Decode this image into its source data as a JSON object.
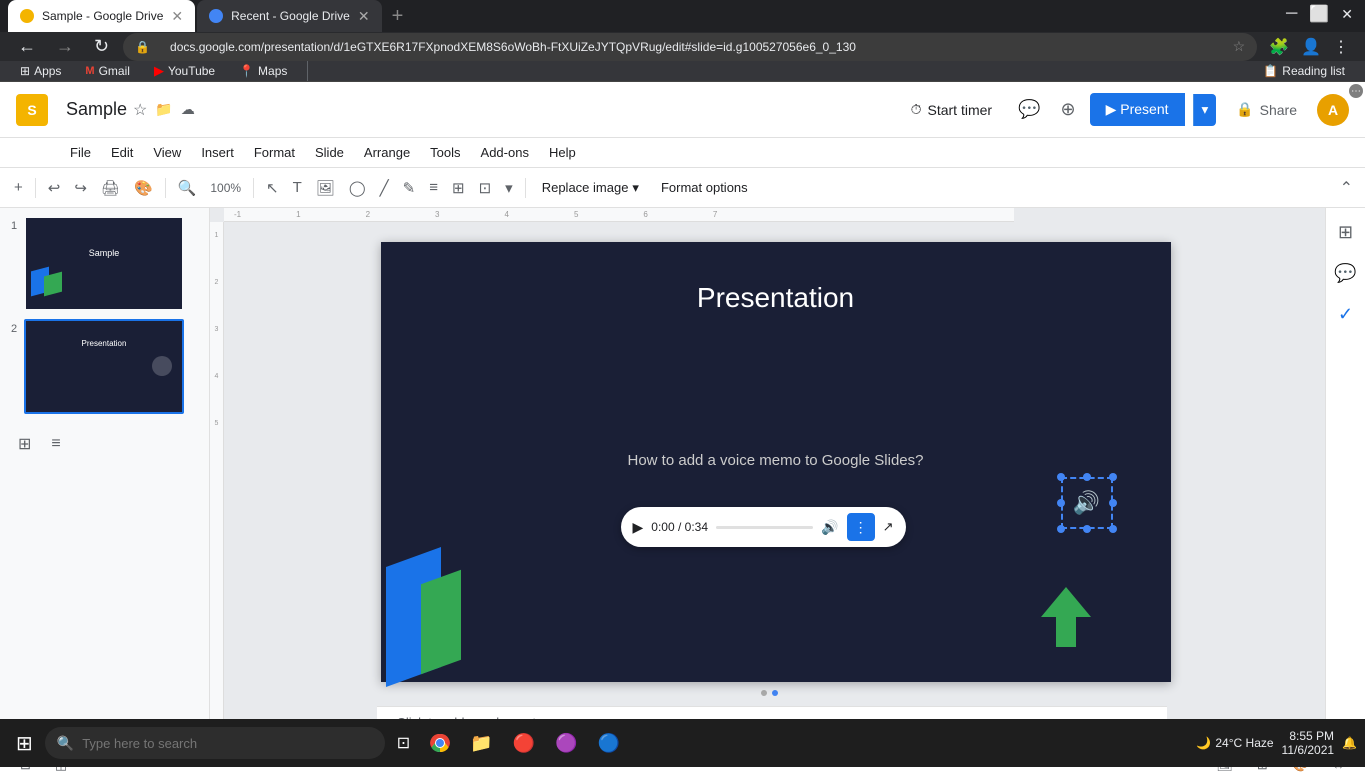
{
  "browser": {
    "tabs": [
      {
        "id": "tab1",
        "title": "Sample - Google Drive",
        "favicon": "📄",
        "active": true
      },
      {
        "id": "tab2",
        "title": "Recent - Google Drive",
        "favicon": "🔵",
        "active": false
      }
    ],
    "address": "docs.google.com/presentation/d/1eGTXE6R17FXpnodXEM8S6oWoBh-FtXUiZeJYTQpVRug/edit#slide=id.g100527056e6_0_130",
    "bookmarks": [
      {
        "id": "apps",
        "label": "Apps",
        "icon": "⚙"
      },
      {
        "id": "gmail",
        "label": "Gmail",
        "icon": "M"
      },
      {
        "id": "youtube",
        "label": "YouTube",
        "icon": "▶"
      },
      {
        "id": "maps",
        "label": "Maps",
        "icon": "📍"
      }
    ],
    "reading_list": "Reading list"
  },
  "app": {
    "title": "Sample",
    "logo_letter": "S",
    "menu": [
      "File",
      "Edit",
      "View",
      "Insert",
      "Format",
      "Slide",
      "Arrange",
      "Tools",
      "Add-ons",
      "Help"
    ],
    "header": {
      "start_timer": "Start timer",
      "present": "Present",
      "share": "Share",
      "user_initial": "A"
    },
    "toolbar": {
      "replace_image": "Replace image",
      "format_options": "Format options"
    },
    "slides": [
      {
        "num": "1",
        "title": "Sample"
      },
      {
        "num": "2",
        "title": "Presentation"
      }
    ],
    "slide": {
      "title": "Presentation",
      "subtitle": "How to add a voice memo to Google Slides?",
      "audio_time": "0:00 / 0:34"
    },
    "speaker_notes": "Click to add speaker notes"
  },
  "taskbar": {
    "search_placeholder": "Type here to search",
    "weather": "24°C  Haze",
    "time": "8:55 PM",
    "date": "11/6/2021"
  }
}
